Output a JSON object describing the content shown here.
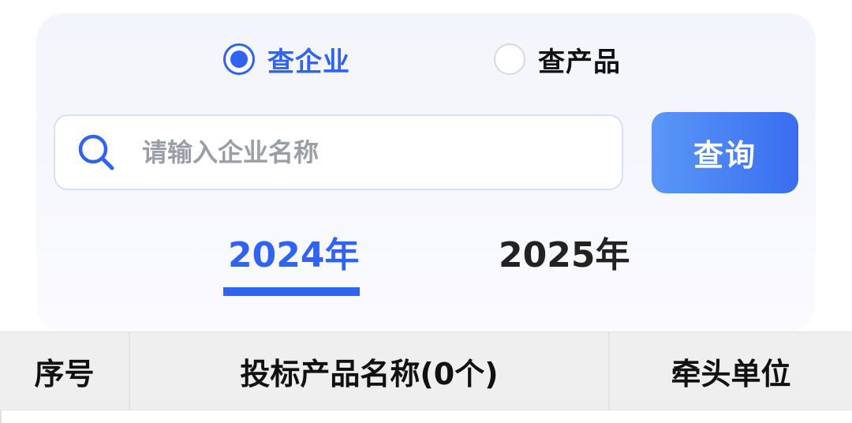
{
  "search_type": {
    "options": [
      {
        "label": "查企业",
        "selected": true
      },
      {
        "label": "查产品",
        "selected": false
      }
    ]
  },
  "search": {
    "placeholder": "请输入企业名称",
    "value": "",
    "button_label": "查询"
  },
  "year_tabs": [
    {
      "label": "2024年",
      "active": true
    },
    {
      "label": "2025年",
      "active": false
    }
  ],
  "table": {
    "columns": [
      "序号",
      "投标产品名称(0个)",
      "牵头单位"
    ],
    "rows": []
  },
  "colors": {
    "accent": "#2f63f0",
    "button_gradient_start": "#5a97f6",
    "button_gradient_end": "#3a6df0",
    "header_bg": "#efefef"
  }
}
